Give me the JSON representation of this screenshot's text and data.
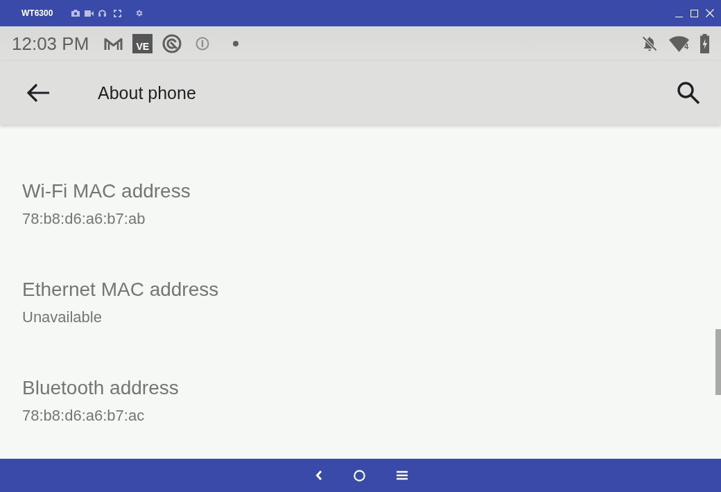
{
  "window": {
    "title": "WT6300"
  },
  "status_bar": {
    "time": "12:03 PM",
    "notification_tile": "VE",
    "signal_badge": "4"
  },
  "app_bar": {
    "title": "About phone"
  },
  "items": [
    {
      "title": "Wi-Fi MAC address",
      "value": "78:b8:d6:a6:b7:ab"
    },
    {
      "title": "Ethernet MAC address",
      "value": "Unavailable"
    },
    {
      "title": "Bluetooth address",
      "value": "78:b8:d6:a6:b7:ac"
    }
  ]
}
